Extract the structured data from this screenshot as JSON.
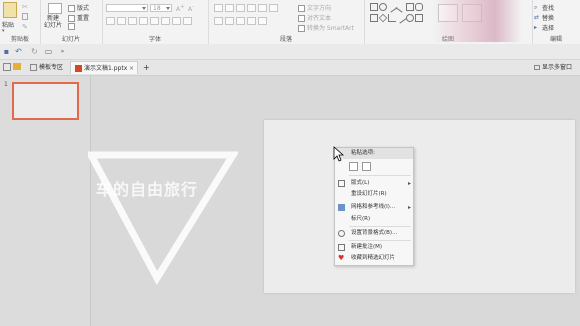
{
  "ribbon": {
    "groups": {
      "clipboard": {
        "label": "剪贴板",
        "paste_label": "粘贴"
      },
      "slides": {
        "label": "幻灯片",
        "new_slide_label": "新建\n幻灯片",
        "layout_label": "版式",
        "reset_label": "重置"
      },
      "font": {
        "label": "字体",
        "font_size": "18"
      },
      "paragraph": {
        "label": "段落",
        "text_direction": "文字方向",
        "align_text": "对齐文本",
        "smartart": "转换为 SmartArt"
      },
      "drawing": {
        "label": "绘图"
      },
      "editing": {
        "label": "编辑",
        "find": "查找",
        "replace": "替换",
        "select": "选择"
      }
    }
  },
  "qat": {
    "save_icon": "save-icon",
    "undo_icon": "undo-icon",
    "redo_icon": "redo-icon"
  },
  "tabs": {
    "templates_label": "模板专区",
    "doc_label": "演示文稿1.pptx",
    "new_tab_label": "+",
    "show_multiwindow_label": "显示多窗口"
  },
  "thumbnail": {
    "number": "1"
  },
  "watermark": {
    "text": "车的自由旅行"
  },
  "context_menu": {
    "header": "粘贴选项:",
    "items": [
      {
        "label": "版式(L)",
        "has_submenu": true
      },
      {
        "label": "重设幻灯片(R)",
        "has_submenu": false
      },
      {
        "label": "网格和参考线(I)...",
        "has_submenu": true
      },
      {
        "label": "标尺(R)",
        "has_submenu": false
      },
      {
        "label": "设置背景格式(B)...",
        "has_submenu": false
      },
      {
        "label": "新建批注(M)",
        "has_submenu": false
      },
      {
        "label": "收藏到精选幻灯片",
        "has_submenu": false
      }
    ],
    "submenu_arrow": "▸"
  },
  "colors": {
    "accent_orange": "#e26a4c",
    "favorite_red": "#d9302e",
    "icon_blue": "#4a6fa5"
  }
}
